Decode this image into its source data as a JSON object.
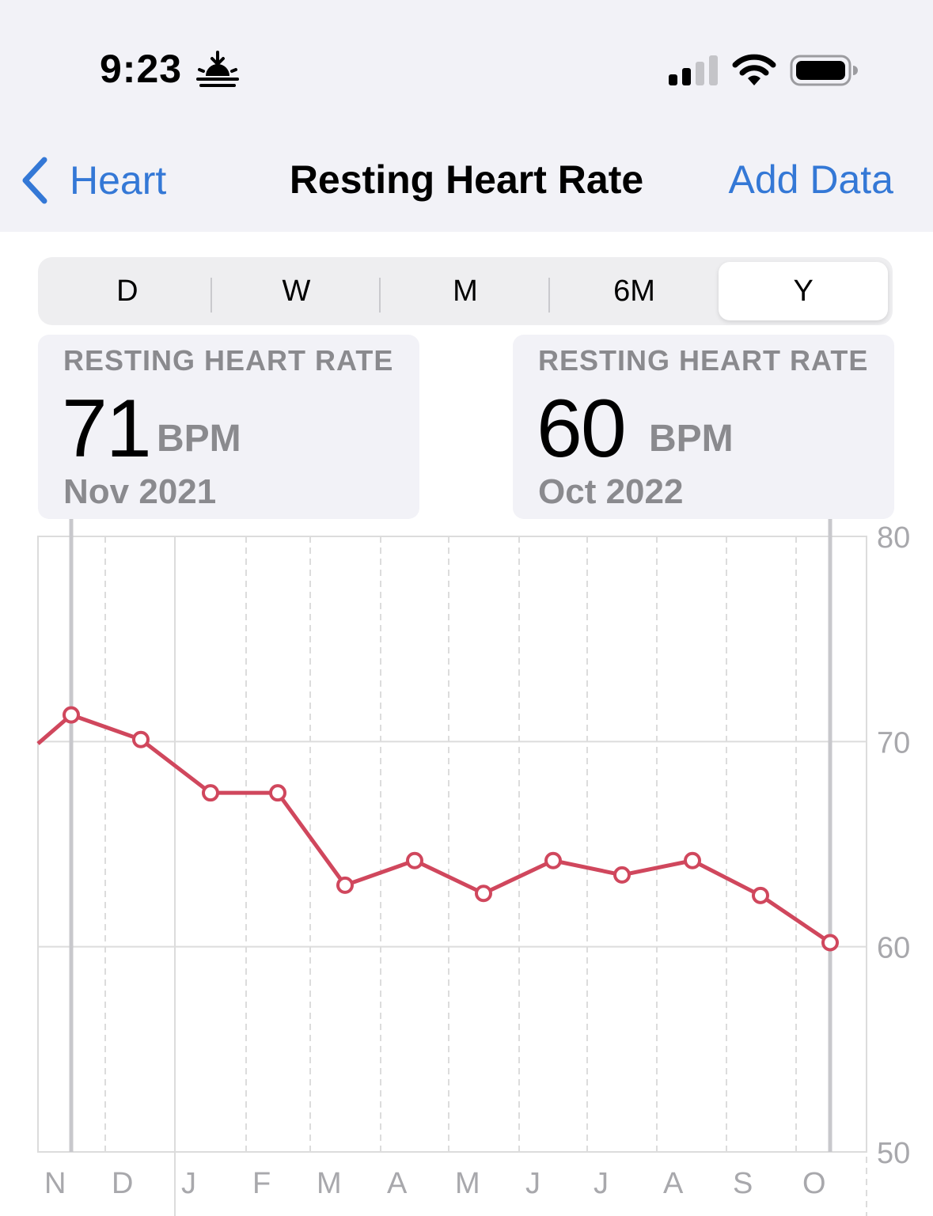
{
  "status_bar": {
    "time": "9:23",
    "icons": [
      "sunrise-icon",
      "cellular-signal-icon",
      "wifi-icon",
      "battery-icon"
    ]
  },
  "nav": {
    "back_label": "Heart",
    "title": "Resting Heart Rate",
    "add_label": "Add Data",
    "accent": "#3478d6"
  },
  "segments": [
    {
      "label": "D",
      "active": false
    },
    {
      "label": "W",
      "active": false
    },
    {
      "label": "M",
      "active": false
    },
    {
      "label": "6M",
      "active": false
    },
    {
      "label": "Y",
      "active": true
    }
  ],
  "cards": [
    {
      "label": "RESTING HEART RATE",
      "value": "71",
      "unit": "BPM",
      "date": "Nov 2021"
    },
    {
      "label": "RESTING HEART RATE",
      "value": "60",
      "unit": "BPM",
      "date": "Oct 2022"
    }
  ],
  "chart_data": {
    "type": "line",
    "categories": [
      "N",
      "D",
      "J",
      "F",
      "M",
      "A",
      "M",
      "J",
      "J",
      "A",
      "S",
      "O"
    ],
    "series": [
      {
        "values": [
          71.3,
          70.1,
          67.5,
          67.5,
          63.0,
          64.2,
          62.6,
          64.2,
          63.5,
          64.2,
          62.5,
          60.2
        ],
        "color": "#d0475d"
      }
    ],
    "leading_value": 69.9,
    "ylim": [
      50,
      80
    ],
    "yticks": [
      80,
      70,
      60,
      50
    ],
    "selected_range": [
      "N",
      "O"
    ],
    "grid": true,
    "colors": {
      "line": "#d0475d",
      "grid": "#dcdcdc",
      "axis_text": "#a8a8ac",
      "selection": "#c8c8cc"
    }
  }
}
